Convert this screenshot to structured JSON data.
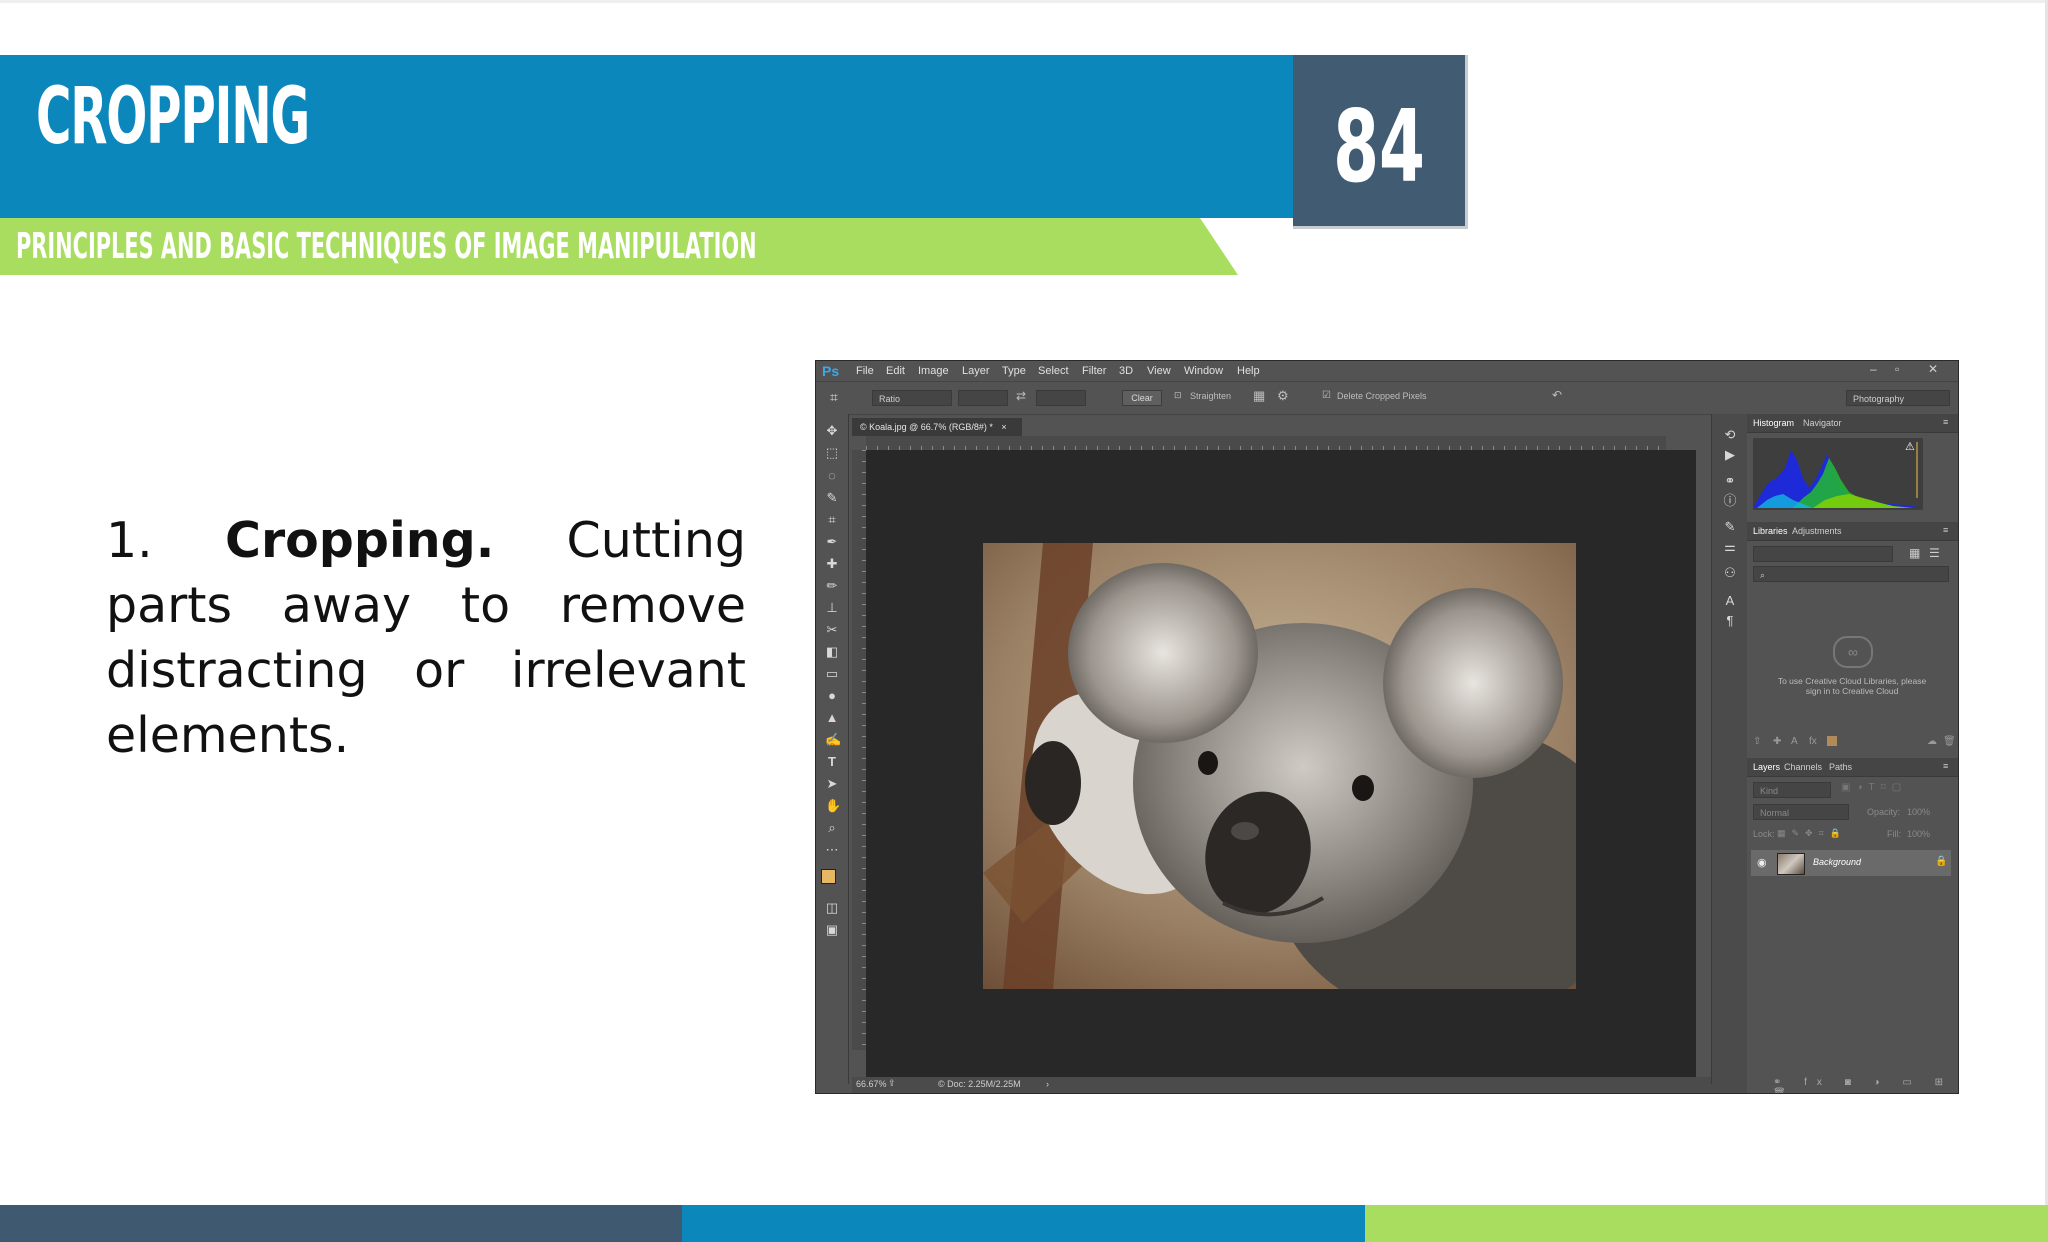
{
  "slide": {
    "title": "CROPPING",
    "page_number": "84",
    "subtitle": "PRINCIPLES AND BASIC TECHNIQUES OF IMAGE MANIPULATION",
    "point_number": "1.",
    "point_term": "Cropping.",
    "point_text": " Cutting parts away to remove distracting or irrelevant elements."
  },
  "colors": {
    "blue": "#0b87bc",
    "slate": "#415b72",
    "green": "#a9dd5f",
    "ps_dark": "#535353"
  },
  "photoshop": {
    "logo": "Ps",
    "menu": [
      "File",
      "Edit",
      "Image",
      "Layer",
      "Type",
      "Select",
      "Filter",
      "3D",
      "View",
      "Window",
      "Help"
    ],
    "options": {
      "ratio": "Ratio",
      "clear": "Clear",
      "straighten": "Straighten",
      "delete_cropped": "Delete Cropped Pixels",
      "workspace": "Photography"
    },
    "document_tab": "© Koala.jpg @ 66.7% (RGB/8#) *",
    "ruler_numbers": [
      "2",
      "0",
      "1",
      "2",
      "3",
      "4",
      "5",
      "6",
      "7",
      "8",
      "9",
      "10",
      "11",
      "12"
    ],
    "status": {
      "zoom": "66.67%",
      "doc": "© Doc: 2.25M/2.25M"
    },
    "panels": {
      "histogram_tab": "Histogram",
      "navigator_tab": "Navigator",
      "libraries_tab": "Libraries",
      "adjustments_tab": "Adjustments",
      "cc_message": "To use Creative Cloud Libraries, please sign in to Creative Cloud",
      "layers_tab": "Layers",
      "channels_tab": "Channels",
      "paths_tab": "Paths",
      "kind_placeholder": "Kind",
      "blend_mode": "Normal",
      "opacity_label": "Opacity:",
      "opacity_value": "100%",
      "lock_label": "Lock:",
      "fill_label": "Fill:",
      "fill_value": "100%",
      "layer_name": "Background"
    }
  }
}
